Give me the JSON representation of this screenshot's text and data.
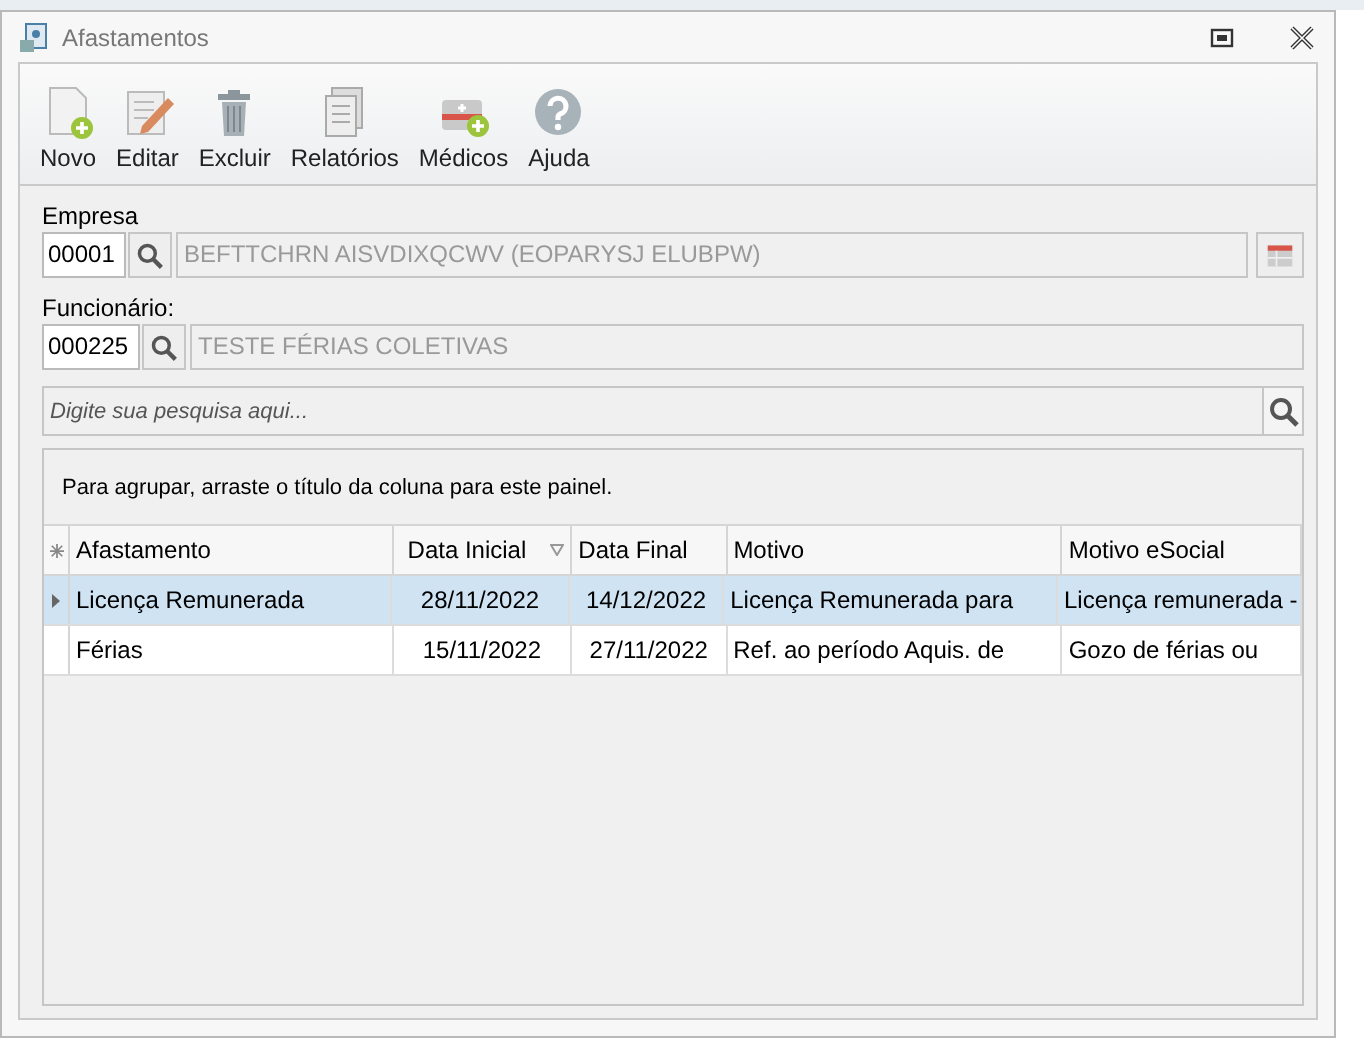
{
  "window": {
    "title": "Afastamentos"
  },
  "toolbar": [
    {
      "label": "Novo",
      "kind": "new"
    },
    {
      "label": "Editar",
      "kind": "edit"
    },
    {
      "label": "Excluir",
      "kind": "delete"
    },
    {
      "label": "Relatórios",
      "kind": "report"
    },
    {
      "label": "Médicos",
      "kind": "medic"
    },
    {
      "label": "Ajuda",
      "kind": "help"
    }
  ],
  "empresa": {
    "label": "Empresa",
    "code": "00001",
    "name": "BEFTTCHRN AISVDIXQCWV (EOPARYSJ ELUBPW)"
  },
  "funcionario": {
    "label": "Funcionário:",
    "code": "000225",
    "name": "TESTE FÉRIAS COLETIVAS"
  },
  "search": {
    "placeholder": "Digite sua pesquisa aqui..."
  },
  "grid": {
    "group_hint": "Para agrupar, arraste o título da coluna para este painel.",
    "columns": [
      {
        "label": "Afastamento",
        "sorted": false
      },
      {
        "label": "Data Inicial",
        "sorted": true
      },
      {
        "label": "Data Final",
        "sorted": false
      },
      {
        "label": "Motivo",
        "sorted": false
      },
      {
        "label": "Motivo eSocial",
        "sorted": false
      }
    ],
    "rows": [
      {
        "selected": true,
        "cells": [
          "Licença Remunerada",
          "28/11/2022",
          "14/12/2022",
          "Licença Remunerada para",
          "Licença remunerada -"
        ]
      },
      {
        "selected": false,
        "cells": [
          "Férias",
          "15/11/2022",
          "27/11/2022",
          "Ref. ao período Aquis. de",
          "Gozo de férias ou"
        ]
      }
    ]
  }
}
